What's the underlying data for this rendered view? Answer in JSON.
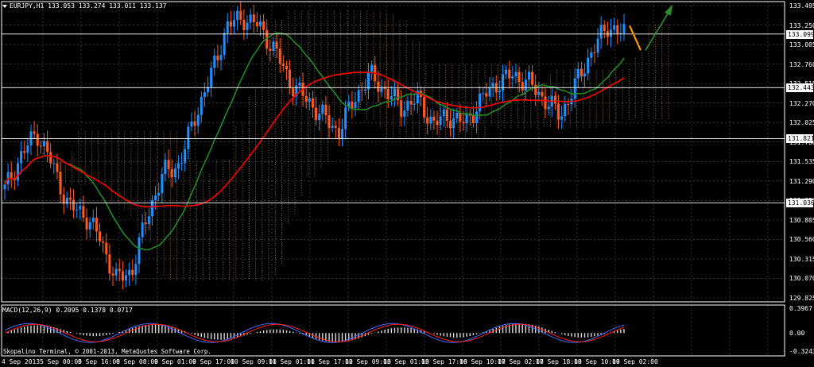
{
  "header": {
    "symbol_line": "EURJPY,H1  133.053 133.274 133.011 133.137",
    "macd_line": "MACD(12,26,9) 0.2095 0.1378 0.0717"
  },
  "footer": {
    "copyright": "Skopalino Terminal, © 2001-2013, MetaQuotes Software Corp."
  },
  "price_axis": {
    "labels": [
      "133.495",
      "133.250",
      "133.005",
      "132.760",
      "132.515",
      "132.270",
      "132.025",
      "131.780",
      "131.535",
      "131.290",
      "131.036",
      "130.805",
      "130.560",
      "130.315",
      "130.070",
      "129.825"
    ],
    "tags": [
      "133.099",
      "132.443",
      "131.821",
      "131.036"
    ]
  },
  "macd_axis": {
    "labels": [
      "0.3967",
      "0.00",
      "-0.3243"
    ]
  },
  "time_axis": {
    "labels": [
      "4 Sep 2013",
      "5 Sep 00:00",
      "5 Sep 16:00",
      "6 Sep 08:00",
      "9 Sep 01:00",
      "9 Sep 17:00",
      "10 Sep 09:00",
      "11 Sep 01:00",
      "11 Sep 17:00",
      "12 Sep 09:00",
      "13 Sep 01:00",
      "13 Sep 17:00",
      "16 Sep 10:00",
      "17 Sep 02:00",
      "17 Sep 18:00",
      "18 Sep 10:00",
      "19 Sep 02:00"
    ]
  },
  "colors": {
    "bull": "#1e90ff",
    "bear": "#ff5a1e",
    "ma_fast": "#228b22",
    "ma_slow": "#ff0000",
    "cloud": "#e8b48a",
    "grid": "#5a5a5a",
    "orange_arrow": "#ff9900",
    "green_arrow": "#2e8b2e"
  },
  "chart_data": {
    "type": "line",
    "title": "EURJPY,H1",
    "ylim": [
      129.825,
      133.495
    ],
    "macd_ylim": [
      -0.3243,
      0.3967
    ],
    "horizontal_levels": [
      133.099,
      132.443,
      131.821,
      131.036
    ],
    "series": [
      {
        "values": [
          131.2,
          131.6,
          131.9,
          131.5,
          131.0,
          130.9,
          130.6,
          130.1,
          130.2,
          130.9,
          131.4,
          131.5,
          132.1,
          132.6,
          133.2,
          133.3,
          133.2,
          132.9,
          132.5,
          132.3,
          132.1,
          131.9,
          132.3,
          132.6,
          132.4,
          132.2,
          132.3,
          132.0,
          132.1,
          132.0,
          132.3,
          132.5,
          132.6,
          132.5,
          132.3,
          132.1,
          132.5,
          132.9,
          133.2,
          133.1
        ]
      }
    ]
  }
}
